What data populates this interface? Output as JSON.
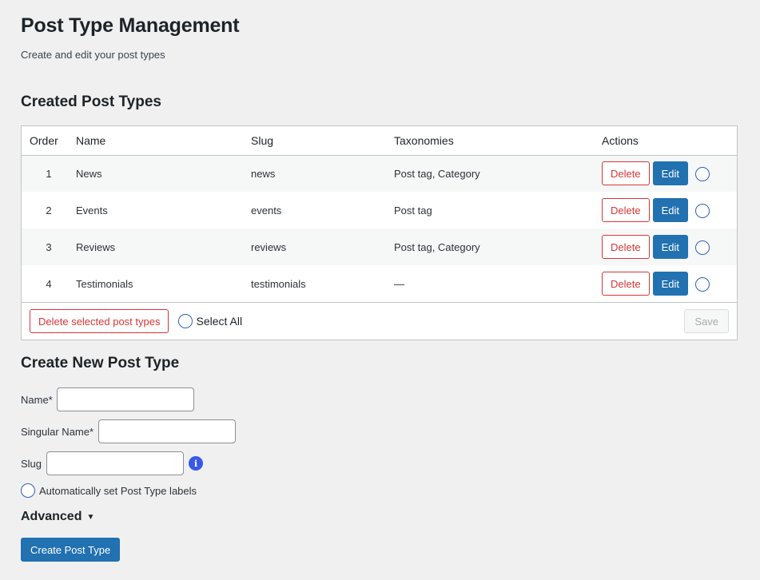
{
  "page": {
    "title": "Post Type Management",
    "subtitle": "Create and edit your post types"
  },
  "created": {
    "heading": "Created Post Types",
    "columns": {
      "order": "Order",
      "name": "Name",
      "slug": "Slug",
      "taxonomies": "Taxonomies",
      "actions": "Actions"
    },
    "rows": [
      {
        "order": "1",
        "name": "News",
        "slug": "news",
        "taxonomies": "Post tag, Category",
        "delete": "Delete",
        "edit": "Edit"
      },
      {
        "order": "2",
        "name": "Events",
        "slug": "events",
        "taxonomies": "Post tag",
        "delete": "Delete",
        "edit": "Edit"
      },
      {
        "order": "3",
        "name": "Reviews",
        "slug": "reviews",
        "taxonomies": "Post tag, Category",
        "delete": "Delete",
        "edit": "Edit"
      },
      {
        "order": "4",
        "name": "Testimonials",
        "slug": "testimonials",
        "taxonomies": "—",
        "delete": "Delete",
        "edit": "Edit"
      }
    ],
    "footer": {
      "delete_selected": "Delete selected post types",
      "select_all": "Select All",
      "save": "Save"
    }
  },
  "create": {
    "heading": "Create New Post Type",
    "name_label": "Name*",
    "name_value": "",
    "singular_label": "Singular Name*",
    "singular_value": "",
    "slug_label": "Slug",
    "slug_value": "",
    "info_icon": "info-icon",
    "auto_labels": "Automatically set Post Type labels",
    "advanced": "Advanced",
    "advanced_caret": "▼",
    "submit": "Create Post Type"
  },
  "colors": {
    "primary": "#2271b1",
    "danger": "#d63638",
    "background": "#f0f0f1",
    "info": "#3858e9"
  }
}
